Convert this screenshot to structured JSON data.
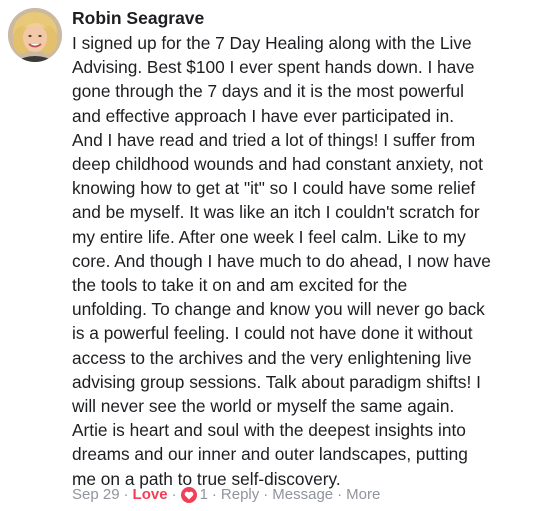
{
  "comment": {
    "author": "Robin Seagrave",
    "avatar_icon": "profile-photo",
    "text_lines": [
      "I signed up for the 7 Day Healing along with the Live",
      "Advising. Best $100 I ever spent hands down. I have",
      "gone through the 7 days and it is the most powerful",
      "and effective approach I have ever participated in.",
      "And I have read and tried a lot of things! I suffer from",
      "deep childhood wounds and had constant anxiety, not",
      "knowing how to get at \"it\" so I could have some relief",
      "and be myself. It was like an itch I couldn't scratch for",
      "my entire life. After one week I feel calm. Like to my",
      "core. And though I have much to do ahead, I now have",
      "the tools to take it on and am excited for the",
      "unfolding. To change and know you will never go back",
      "is a powerful feeling. I could not have done it without",
      "access to the archives and the very enlightening live",
      "advising group sessions. Talk about paradigm shifts! I",
      "will never see the world or myself the same again.",
      "Artie is heart and soul with the deepest insights into",
      "dreams and our inner and outer landscapes, putting",
      "me on a path to true self-discovery."
    ]
  },
  "actions": {
    "timestamp": "Sep 29",
    "separator": "·",
    "love_label": "Love",
    "reaction_count": "1",
    "reaction_icon": "heart-icon",
    "reply_label": "Reply",
    "message_label": "Message",
    "more_label": "More"
  },
  "colors": {
    "love": "#f33e58",
    "meta": "#90949c",
    "text": "#1c1e21"
  }
}
